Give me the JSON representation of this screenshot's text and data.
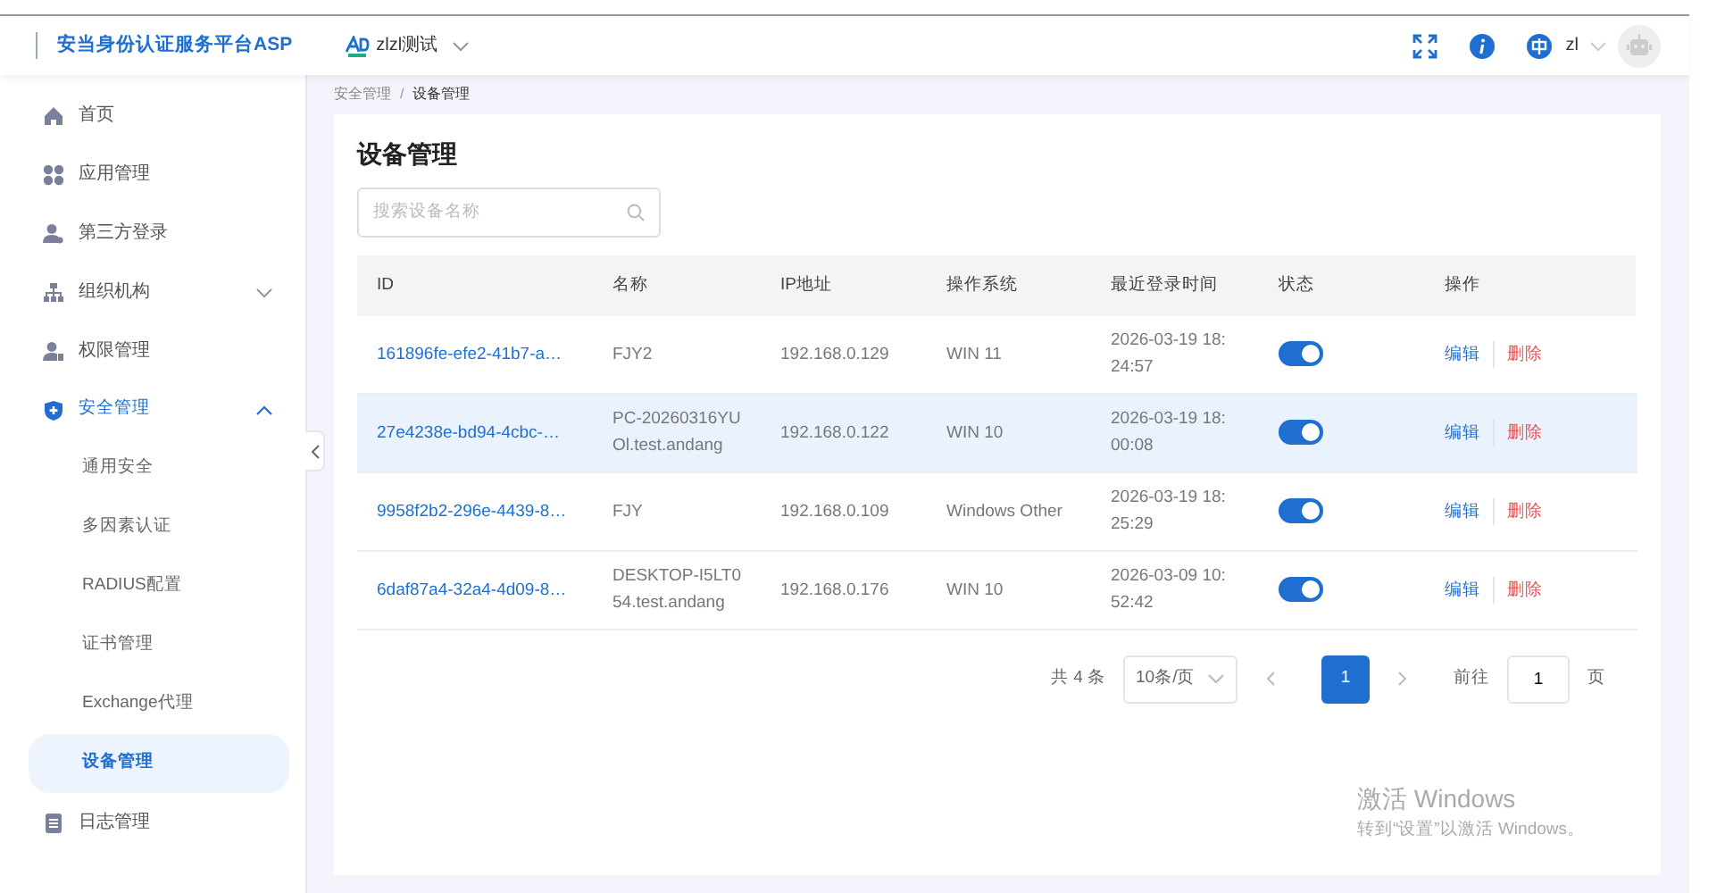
{
  "header": {
    "brand": "安当身份认证服务平台ASP",
    "tenant": "zlzl测试",
    "user": "zl"
  },
  "sidebar": {
    "items": [
      {
        "label": "首页",
        "selected": false
      },
      {
        "label": "应用管理",
        "selected": false
      },
      {
        "label": "第三方登录",
        "selected": false
      },
      {
        "label": "组织机构",
        "selected": false,
        "expanded": false
      },
      {
        "label": "权限管理",
        "selected": false
      },
      {
        "label": "安全管理",
        "selected": true,
        "expanded": true,
        "children": [
          {
            "label": "通用安全",
            "selected": false
          },
          {
            "label": "多因素认证",
            "selected": false
          },
          {
            "label": "RADIUS配置",
            "selected": false
          },
          {
            "label": "证书管理",
            "selected": false
          },
          {
            "label": "Exchange代理",
            "selected": false
          },
          {
            "label": "设备管理",
            "selected": true
          }
        ]
      },
      {
        "label": "日志管理",
        "selected": false
      }
    ]
  },
  "breadcrumb": {
    "items": [
      "安全管理",
      "设备管理"
    ],
    "separator": "/"
  },
  "page_title": "设备管理",
  "search": {
    "placeholder": "搜索设备名称"
  },
  "table": {
    "columns": [
      "ID",
      "名称",
      "IP地址",
      "操作系统",
      "最近登录时间",
      "状态",
      "操作"
    ],
    "rows": [
      {
        "id": "161896fe-efe2-41b7-a…",
        "name": "FJY2",
        "ip": "192.168.0.129",
        "os": "WIN 11",
        "last_login": "2026-03-19 18:24:57",
        "enabled": true,
        "highlighted": false,
        "actions": [
          "编辑",
          "删除"
        ]
      },
      {
        "id": "27e4238e-bd94-4cbc-…",
        "name": "PC-20260316YUOl.test.andang",
        "ip": "192.168.0.122",
        "os": "WIN 10",
        "last_login": "2026-03-19 18:00:08",
        "enabled": true,
        "highlighted": true,
        "actions": [
          "编辑",
          "删除"
        ]
      },
      {
        "id": "9958f2b2-296e-4439-8…",
        "name": "FJY",
        "ip": "192.168.0.109",
        "os": "Windows Other",
        "last_login": "2026-03-19 18:25:29",
        "enabled": true,
        "highlighted": false,
        "actions": [
          "编辑",
          "删除"
        ]
      },
      {
        "id": "6daf87a4-32a4-4d09-8…",
        "name": "DESKTOP-I5LT054.test.andang",
        "ip": "192.168.0.176",
        "os": "WIN 10",
        "last_login": "2026-03-09 10:52:42",
        "enabled": true,
        "highlighted": false,
        "actions": [
          "编辑",
          "删除"
        ]
      }
    ]
  },
  "pagination": {
    "total": "共 4 条",
    "page_size": "10条/页",
    "pages": [
      {
        "label": "1",
        "selected": true
      }
    ],
    "goto_label": "前往",
    "goto_value": "1",
    "goto_suffix": "页"
  },
  "activation": {
    "title": "激活 Windows",
    "subtitle": "转到“设置”以激活 Windows。"
  }
}
